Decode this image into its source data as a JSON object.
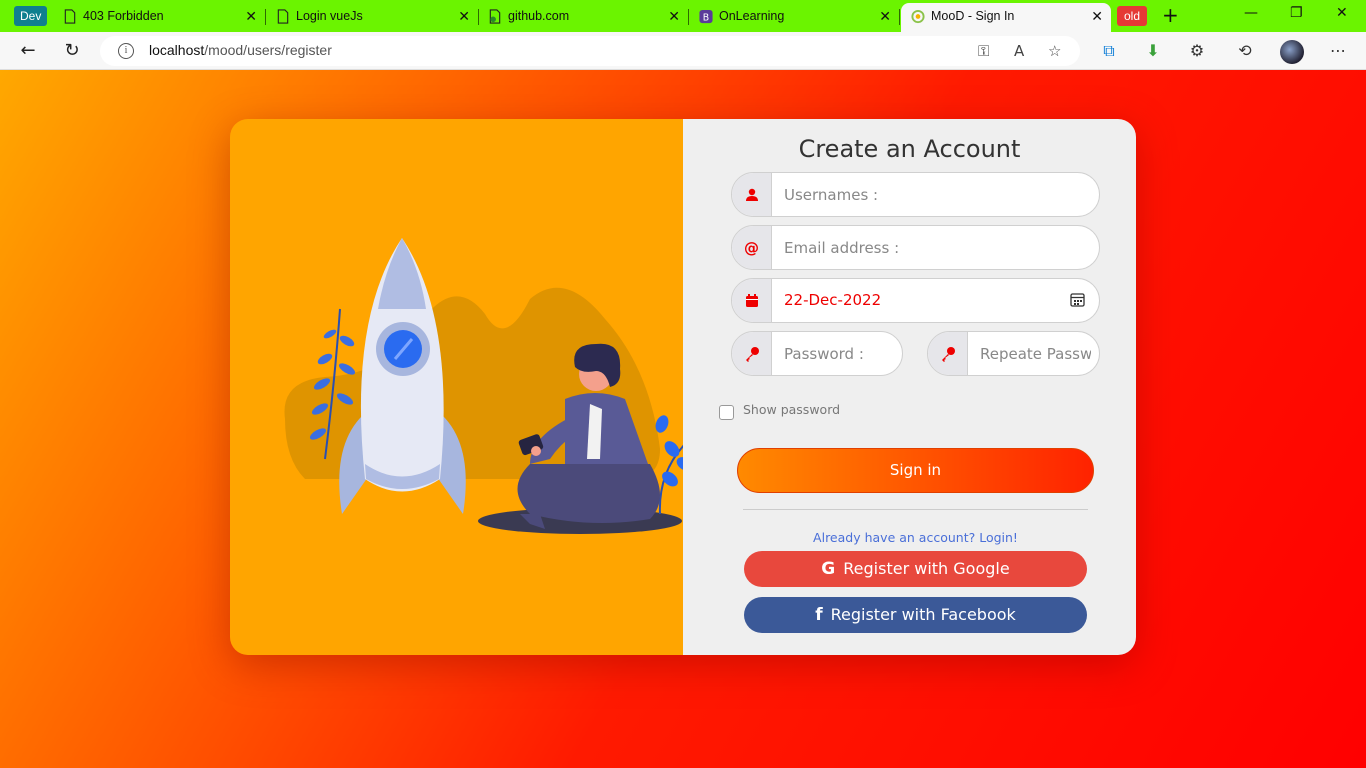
{
  "browser": {
    "profile_label": "Dev",
    "tabs": [
      {
        "title": "403 Forbidden"
      },
      {
        "title": "Login vueJs"
      },
      {
        "title": "github.com"
      },
      {
        "title": "OnLearning"
      },
      {
        "title": "MooD - Sign In"
      }
    ],
    "old_label": "old",
    "url_host": "localhost",
    "url_path": "/mood/users/register"
  },
  "form": {
    "title": "Create an Account",
    "username_placeholder": "Usernames :",
    "email_placeholder": "Email address :",
    "date_value": "22-Dec-2022",
    "password_placeholder": "Password :",
    "repeat_placeholder": "Repeate Password :",
    "show_password_label": "Show password",
    "signin_label": "Sign in",
    "login_link": "Already have an account? Login!",
    "google_label": "Register with Google",
    "facebook_label": "Register with Facebook"
  },
  "colors": {
    "accent": "#ff0000",
    "panel_left": "#ffa500",
    "google": "#e8483d",
    "facebook": "#3b5998"
  }
}
